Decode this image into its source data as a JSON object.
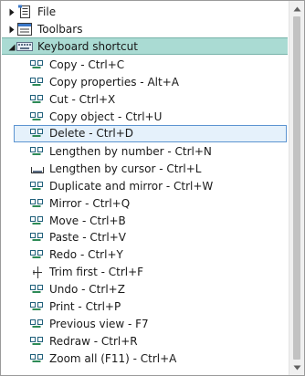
{
  "tree": {
    "top_items": [
      {
        "label": "File",
        "icon": "document-icon",
        "expanded": false
      },
      {
        "label": "Toolbars",
        "icon": "toolbars-icon",
        "expanded": false
      },
      {
        "label": "Keyboard shortcut",
        "icon": "keyboard-icon",
        "expanded": true
      }
    ],
    "shortcuts": [
      {
        "label": "Copy - Ctrl+C",
        "icon": "command-icon"
      },
      {
        "label": "Copy properties - Alt+A",
        "icon": "command-icon"
      },
      {
        "label": "Cut - Ctrl+X",
        "icon": "command-icon"
      },
      {
        "label": "Copy object - Ctrl+U",
        "icon": "command-icon"
      },
      {
        "label": "Delete - Ctrl+D",
        "icon": "command-icon"
      },
      {
        "label": "Lengthen by number - Ctrl+N",
        "icon": "command-icon"
      },
      {
        "label": "Lengthen by cursor - Ctrl+L",
        "icon": "lengthen-cursor-icon"
      },
      {
        "label": "Duplicate and mirror - Ctrl+W",
        "icon": "command-icon"
      },
      {
        "label": "Mirror - Ctrl+Q",
        "icon": "command-icon"
      },
      {
        "label": "Move - Ctrl+B",
        "icon": "command-icon"
      },
      {
        "label": "Paste - Ctrl+V",
        "icon": "command-icon"
      },
      {
        "label": "Redo - Ctrl+Y",
        "icon": "command-icon"
      },
      {
        "label": "Trim first - Ctrl+F",
        "icon": "trim-icon"
      },
      {
        "label": "Undo - Ctrl+Z",
        "icon": "command-icon"
      },
      {
        "label": "Print - Ctrl+P",
        "icon": "command-icon"
      },
      {
        "label": "Previous view - F7",
        "icon": "command-icon"
      },
      {
        "label": "Redraw - Ctrl+R",
        "icon": "command-icon"
      },
      {
        "label": "Zoom all (F11) - Ctrl+A",
        "icon": "command-icon"
      }
    ],
    "focused_shortcut": "Delete - Ctrl+D"
  },
  "colors": {
    "selected_parent_bg": "#aadbd3",
    "focused_row_bg": "#e5f1fb",
    "focused_row_border": "#5c94d1"
  }
}
